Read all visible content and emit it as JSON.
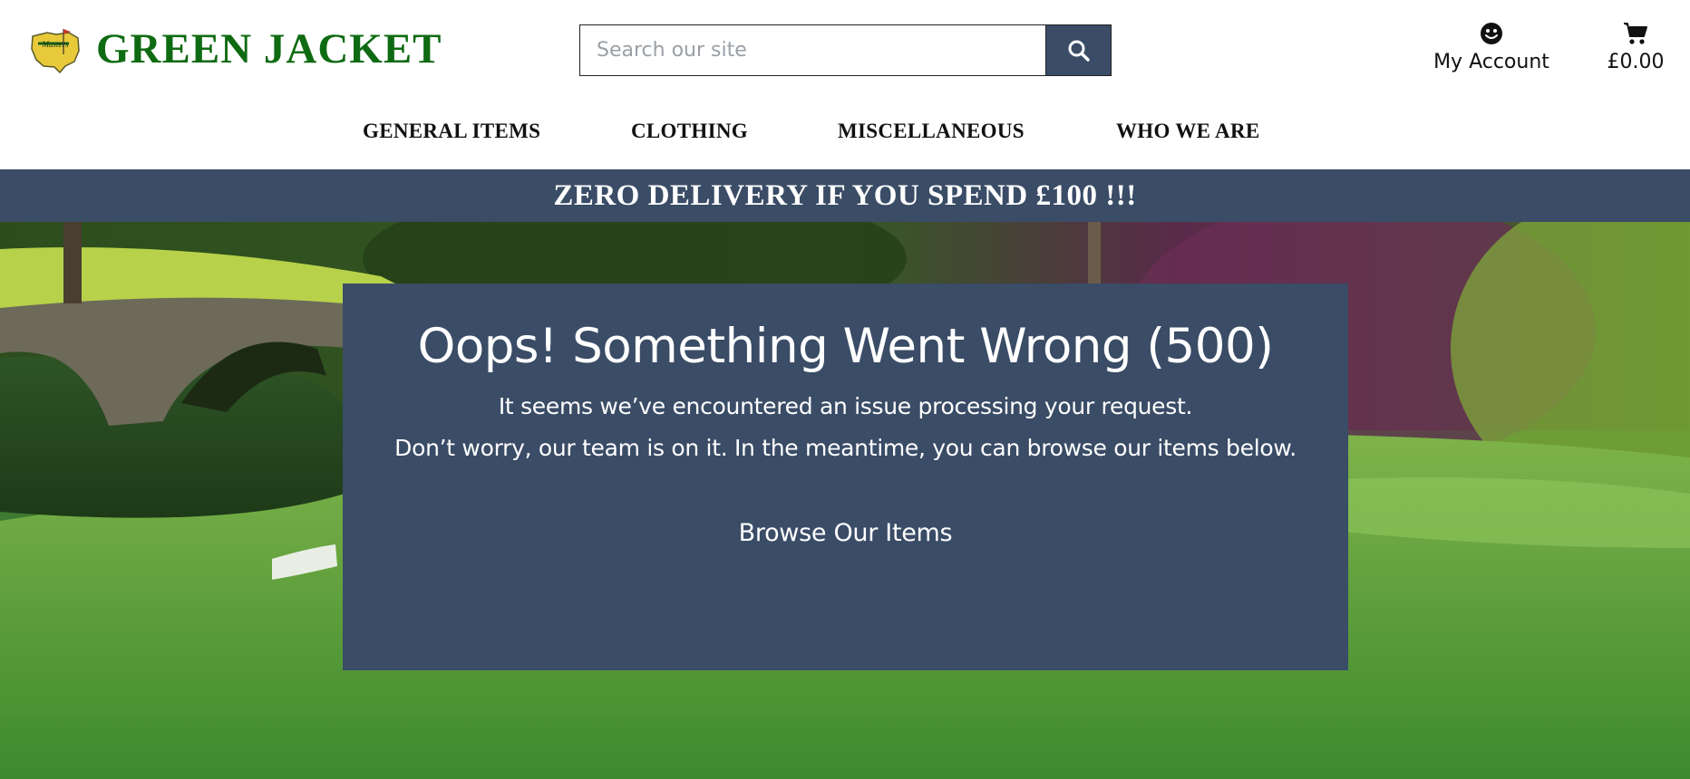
{
  "brand": {
    "name": "GREEN JACKET",
    "logo_icon": "masters-logo-icon",
    "color": "#0f6b12"
  },
  "search": {
    "placeholder": "Search our site",
    "value": "",
    "icon": "search-icon"
  },
  "account": {
    "label": "My Account",
    "icon": "smiley-face-icon"
  },
  "bag": {
    "total": "£0.00",
    "icon": "shopping-cart-icon"
  },
  "nav": {
    "items": [
      {
        "label": "GENERAL ITEMS"
      },
      {
        "label": "CLOTHING"
      },
      {
        "label": "MISCELLANEOUS"
      },
      {
        "label": "WHO WE ARE"
      }
    ]
  },
  "banner": {
    "text": "ZERO DELIVERY IF YOU SPEND £100 !!!"
  },
  "error": {
    "title": "Oops! Something Went Wrong (500)",
    "line1": "It seems we’ve encountered an issue processing your request.",
    "line2": "Don’t worry, our team is on it. In the meantime, you can browse our items below.",
    "button": "Browse Our Items"
  },
  "colors": {
    "accent": "#3a4c66",
    "text_on_accent": "#ffffff"
  }
}
